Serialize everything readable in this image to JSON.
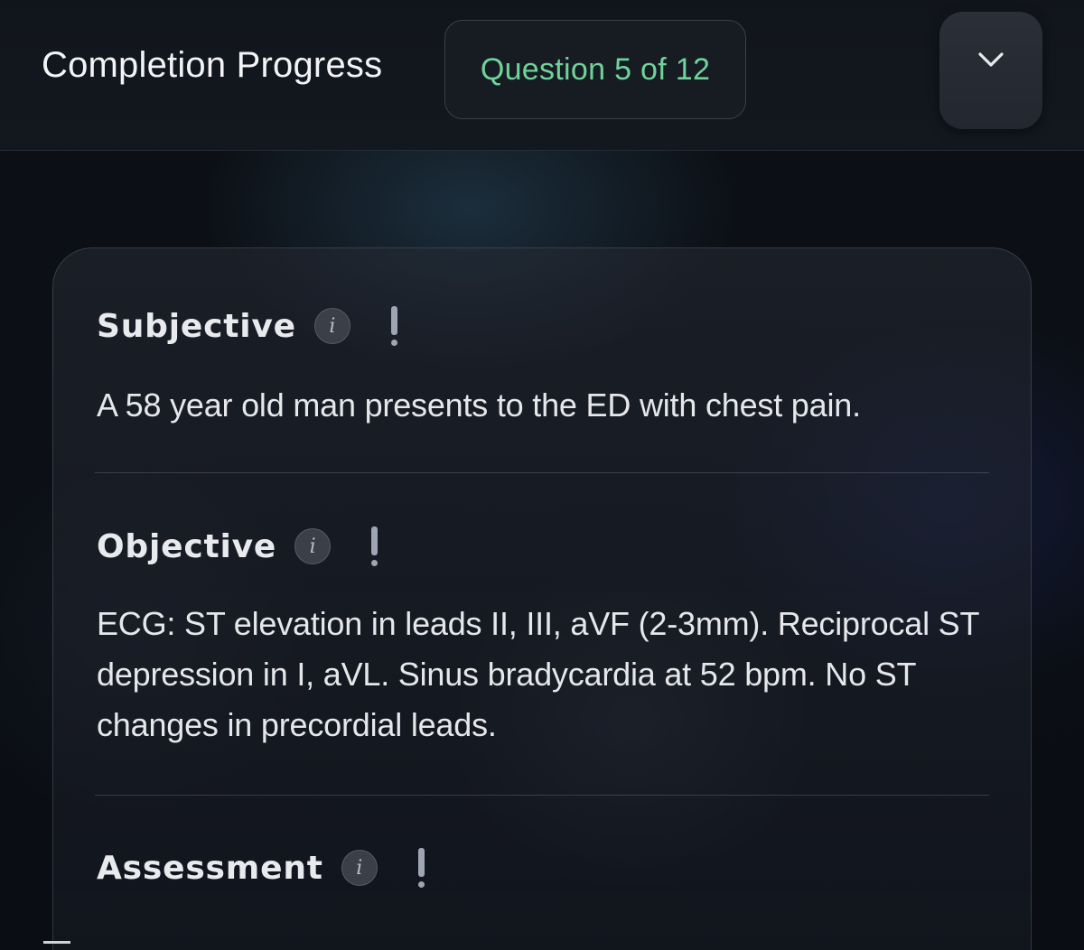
{
  "header": {
    "title": "Completion Progress",
    "question_badge": "Question 5 of 12",
    "collapse_icon": "chevron-down-icon"
  },
  "sections": [
    {
      "title": "Subjective",
      "info_icon_label": "i",
      "body": "A 58 year old man presents to the ED with chest pain."
    },
    {
      "title": "Objective",
      "info_icon_label": "i",
      "body": "ECG: ST elevation in leads II, III, aVF (2-3mm). Reciprocal ST depression in I, aVL. Sinus bradycardia at 52 bpm. No ST changes in precordial leads."
    },
    {
      "title": "Assessment",
      "info_icon_label": "i",
      "body": ""
    }
  ],
  "colors": {
    "accent_green": "#6fd39a",
    "background": "#0b0e14",
    "text": "#e6e7eb"
  }
}
